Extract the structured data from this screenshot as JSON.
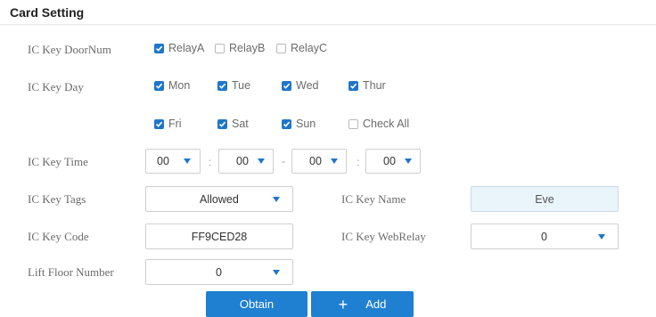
{
  "section": {
    "title": "Card Setting"
  },
  "labels": {
    "door_num": "IC Key DoorNum",
    "day": "IC Key Day",
    "time": "IC Key Time",
    "tags": "IC Key Tags",
    "name": "IC Key Name",
    "code": "IC Key Code",
    "web_relay": "IC Key WebRelay",
    "lift_floor": "Lift Floor Number"
  },
  "relays": [
    {
      "label": "RelayA",
      "checked": true
    },
    {
      "label": "RelayB",
      "checked": false
    },
    {
      "label": "RelayC",
      "checked": false
    }
  ],
  "days_row1": [
    {
      "label": "Mon",
      "checked": true
    },
    {
      "label": "Tue",
      "checked": true
    },
    {
      "label": "Wed",
      "checked": true
    },
    {
      "label": "Thur",
      "checked": true
    }
  ],
  "days_row2": [
    {
      "label": "Fri",
      "checked": true
    },
    {
      "label": "Sat",
      "checked": true
    },
    {
      "label": "Sun",
      "checked": true
    },
    {
      "label": "Check All",
      "checked": false
    }
  ],
  "time": {
    "start_hour": "00",
    "start_minute": "00",
    "end_hour": "00",
    "end_minute": "00",
    "colon": ":",
    "dash": "-"
  },
  "fields": {
    "tags": "Allowed",
    "name": "Eve",
    "code": "FF9CED28",
    "web_relay": "0",
    "lift_floor": "0"
  },
  "buttons": {
    "obtain": "Obtain",
    "add": "Add",
    "add_icon": "+"
  },
  "colors": {
    "accent": "#1f76c9",
    "button": "#1f7fd0",
    "readonly_field_bg": "#eaf4fb"
  }
}
